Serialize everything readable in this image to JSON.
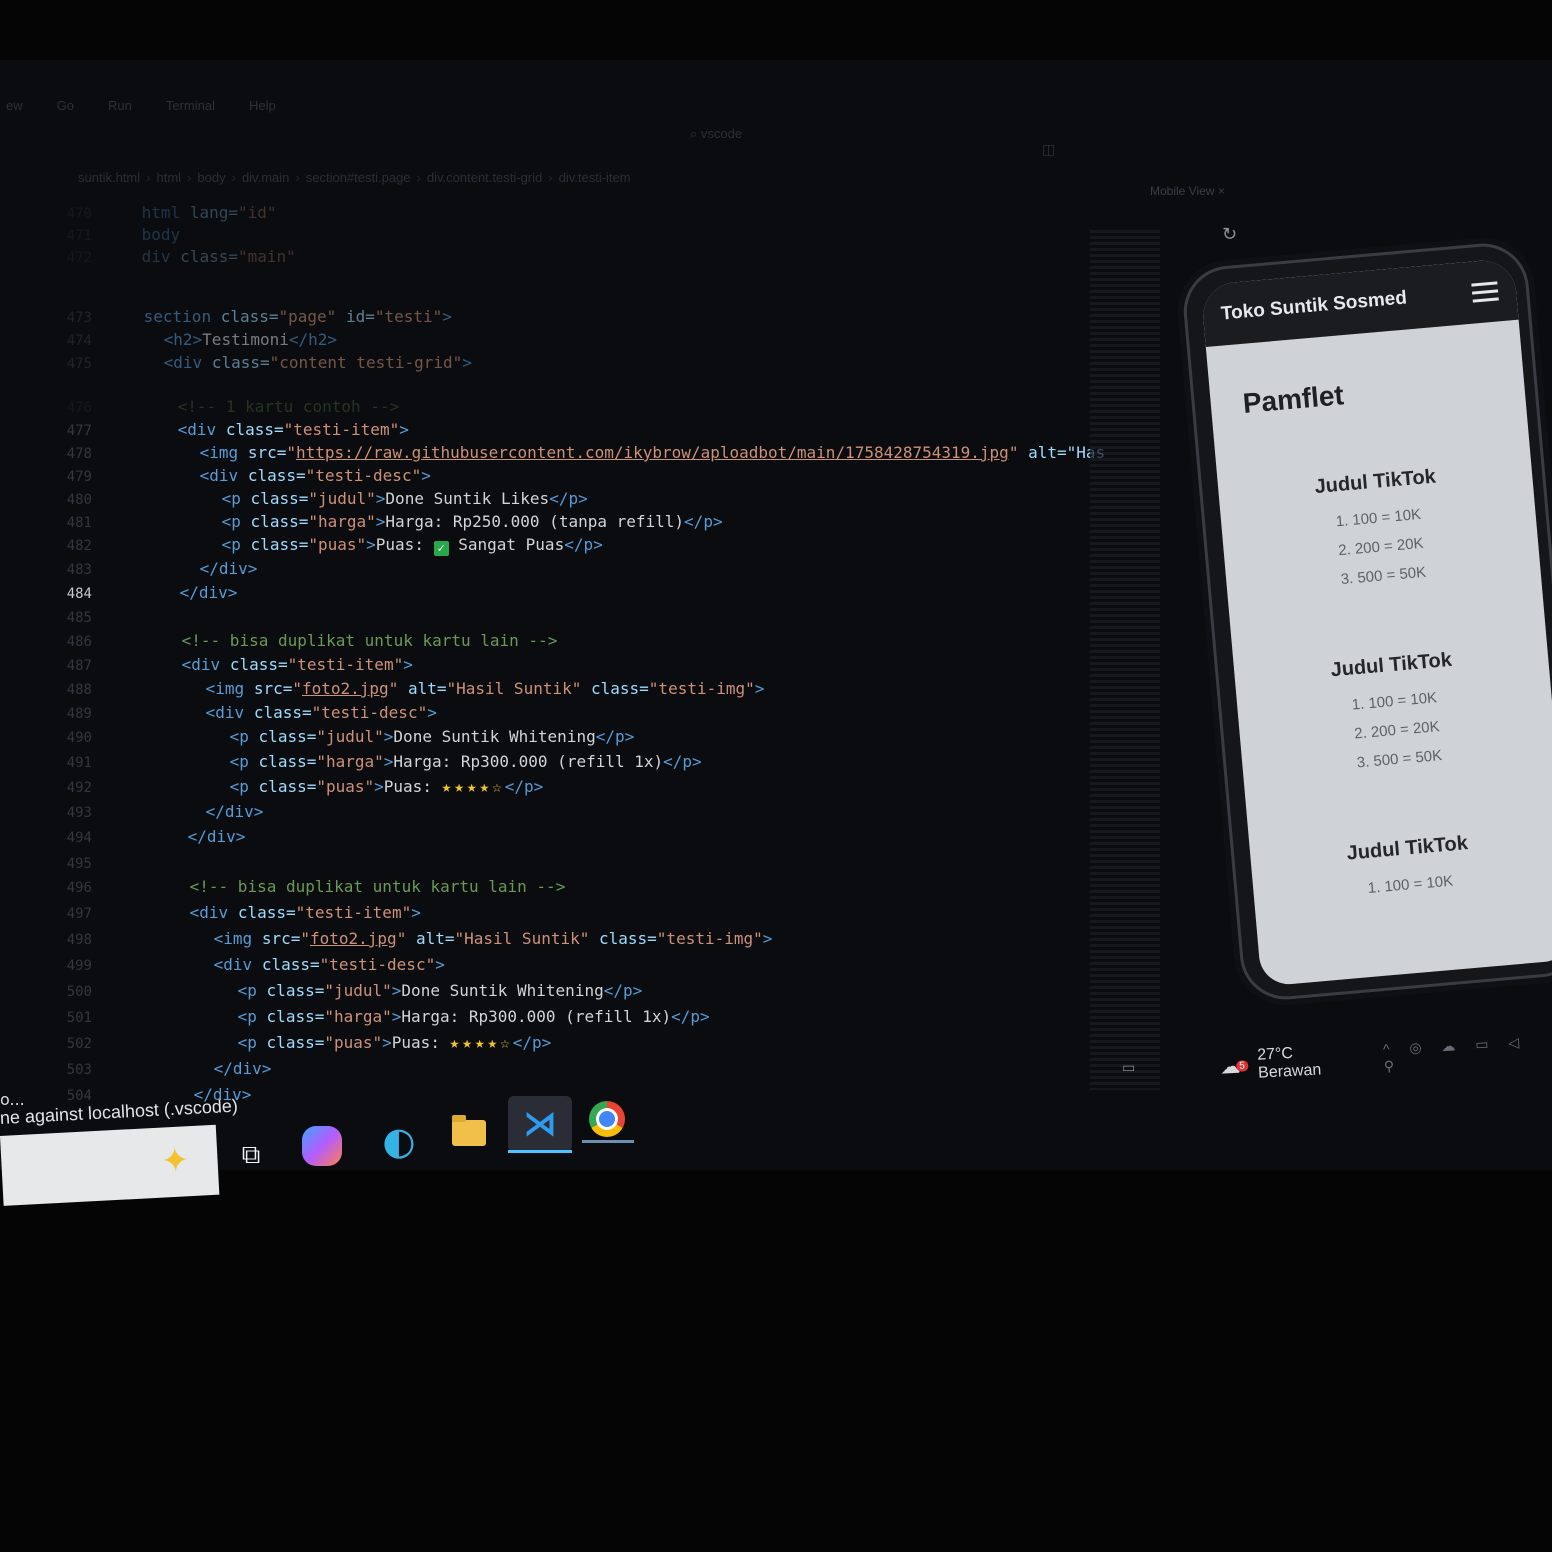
{
  "menu": [
    "ew",
    "Go",
    "Run",
    "Terminal",
    "Help"
  ],
  "window_title": "vscode",
  "breadcrumb": [
    "suntik.html",
    "html",
    "body",
    "div.main",
    "section#testi.page",
    "div.content.testi-grid",
    "div.testi-item"
  ],
  "editor": {
    "current_line": "484",
    "line_numbers": [
      "470",
      "471",
      "472",
      "473",
      "474",
      "475",
      "476",
      "477",
      "478",
      "479",
      "480",
      "481",
      "482",
      "483",
      "484",
      "485",
      "486",
      "487",
      "488",
      "489",
      "490",
      "491",
      "492",
      "493",
      "494",
      "495",
      "496",
      "497",
      "498",
      "499",
      "500",
      "501",
      "502",
      "503",
      "504"
    ],
    "header_lines": {
      "html": "lang=",
      "html_val": "\"id\"",
      "body": "body",
      "div_main_attr": "class=",
      "div_main_val": "\"main\""
    },
    "section": {
      "attr_class": "class=",
      "val_class": "\"page\"",
      "attr_id": "id=",
      "val_id": "\"testi\""
    },
    "h2_text": "Testimoni",
    "grid_val": "\"content testi-grid\"",
    "comment_example": "<!-- 1 kartu contoh -->",
    "comment_dup": "<!-- bisa duplikat untuk kartu lain -->",
    "item_val": "\"testi-item\"",
    "desc_val": "\"testi-desc\"",
    "img_class_val": "\"testi-img\"",
    "card1": {
      "src": "https://raw.githubusercontent.com/ikybrow/aploadbot/main/1758428754319.jpg",
      "alt_partial": "alt=\"Has",
      "judul": "Done Suntik Likes",
      "harga": "Harga: Rp250.000 (tanpa refill)",
      "puas_label": "Puas:",
      "puas_value": "Sangat Puas"
    },
    "card2": {
      "src": "foto2.jpg",
      "alt": "\"Hasil Suntik\"",
      "judul": "Done Suntik Whitening",
      "harga": "Harga: Rp300.000 (refill 1x)",
      "puas_label": "Puas:",
      "stars": "★★★★☆"
    },
    "card3": {
      "src": "foto2.jpg",
      "alt": "\"Hasil Suntik\"",
      "judul": "Done Suntik Whitening",
      "harga": "Harga: Rp300.000 (refill 1x)",
      "puas_label": "Puas:",
      "stars": "★★★★☆"
    }
  },
  "preview": {
    "tab_label": "Mobile View",
    "brand": "Toko Suntik Sosmed",
    "page_title": "Pamflet",
    "cards": [
      {
        "title": "Judul TikTok",
        "items": [
          "1. 100 = 10K",
          "2. 200 = 20K",
          "3. 500 = 50K"
        ]
      },
      {
        "title": "Judul TikTok",
        "items": [
          "1. 100 = 10K",
          "2. 200 = 20K",
          "3. 500 = 50K"
        ]
      },
      {
        "title": "Judul TikTok",
        "items": [
          "1. 100 = 10K"
        ]
      }
    ]
  },
  "tray": {
    "weather": "27°C  Berawan",
    "weather_badge": "5"
  },
  "status": {
    "text": "ne against localhost (.vscode)",
    "dots": "o..."
  },
  "taskbar": [
    "search",
    "task-view",
    "copilot",
    "edge",
    "file-explorer",
    "vscode",
    "chrome"
  ]
}
